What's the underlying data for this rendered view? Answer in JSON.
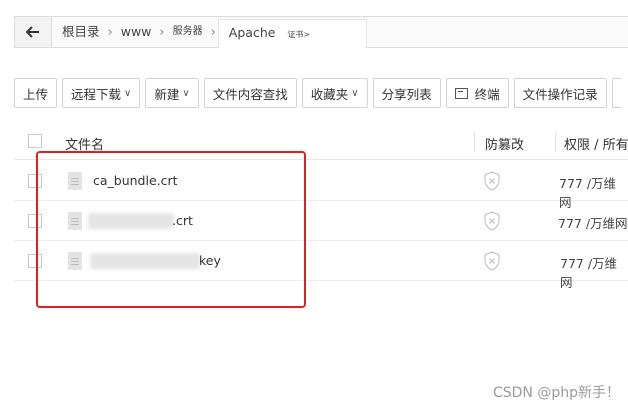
{
  "breadcrumb": {
    "items": [
      "根目录",
      "www",
      "服务器",
      "Apache",
      "证书>"
    ]
  },
  "toolbar": {
    "upload": "上传",
    "remote_download": "远程下载",
    "new": "新建",
    "content_search": "文件内容查找",
    "favorites": "收藏夹",
    "share_list": "分享列表",
    "terminal": "终端",
    "operation_log": "文件操作记录"
  },
  "table": {
    "headers": {
      "name": "文件名",
      "tamper": "防篡改",
      "permission": "权限 / 所有"
    },
    "rows": [
      {
        "name": "ca_bundle.crt",
        "permission": "777 /万维网"
      },
      {
        "name": ".crt",
        "permission": "777 /万维网"
      },
      {
        "name": "key",
        "permission": "777 /万维网"
      }
    ]
  },
  "watermark": "CSDN @php新手！",
  "colors": {
    "highlight_border": "#e02020",
    "border": "#d3d3d3"
  }
}
